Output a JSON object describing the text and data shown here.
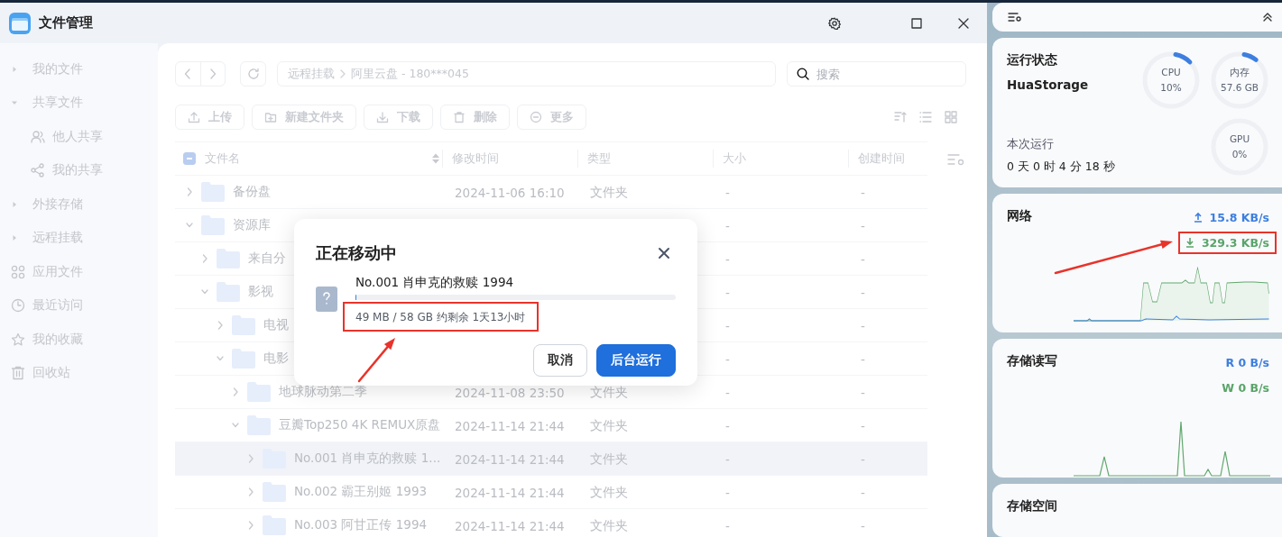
{
  "window": {
    "title": "文件管理"
  },
  "sidebar": {
    "items": [
      {
        "label": "我的文件",
        "kind": "group",
        "expanded": false
      },
      {
        "label": "共享文件",
        "kind": "group",
        "expanded": true,
        "children": [
          {
            "label": "他人共享",
            "kind": "link"
          },
          {
            "label": "我的共享",
            "kind": "link"
          }
        ]
      },
      {
        "label": "外接存储",
        "kind": "group",
        "expanded": false
      },
      {
        "label": "远程挂载",
        "kind": "group",
        "expanded": false
      },
      {
        "label": "应用文件",
        "kind": "link"
      },
      {
        "label": "最近访问",
        "kind": "link"
      },
      {
        "label": "我的收藏",
        "kind": "link"
      },
      {
        "label": "回收站",
        "kind": "link"
      }
    ]
  },
  "breadcrumb": [
    "远程挂载",
    "阿里云盘 - 180***045"
  ],
  "search": {
    "placeholder": "搜索"
  },
  "toolbar": {
    "buttons": [
      "上传",
      "新建文件夹",
      "下载",
      "删除",
      "更多"
    ]
  },
  "table": {
    "select_all_partial": true,
    "columns": [
      "文件名",
      "修改时间",
      "类型",
      "大小",
      "创建时间"
    ],
    "rows": [
      {
        "name": "备份盘",
        "expanded": false,
        "selected": false,
        "modified": "2024-11-06 16:10",
        "type": "文件夹",
        "size": "-",
        "created": "-"
      },
      {
        "name": "资源库",
        "expanded": true,
        "selected": false,
        "size": "-",
        "created": "-",
        "children": [
          {
            "name": "来自分",
            "expanded": false,
            "selected": false,
            "size": "-",
            "created": "-"
          },
          {
            "name": "影视",
            "expanded": true,
            "selected": false,
            "size": "-",
            "created": "-",
            "children": [
              {
                "name": "电视",
                "expanded": false,
                "selected": false,
                "size": "-",
                "created": "-"
              },
              {
                "name": "电影",
                "expanded": true,
                "selected": false,
                "size": "-",
                "created": "-",
                "children": [
                  {
                    "name": "地球脉动第二季",
                    "expanded": false,
                    "selected": false,
                    "modified": "2024-11-08 23:50",
                    "type": "文件夹",
                    "size": "-",
                    "created": "-"
                  },
                  {
                    "name": "豆瓣Top250 4K REMUX原盘",
                    "expanded": true,
                    "selected": false,
                    "modified": "2024-11-14 21:44",
                    "type": "文件夹",
                    "size": "-",
                    "created": "-",
                    "children": [
                      {
                        "name": "No.001 肖申克的救赎 1...",
                        "expanded": false,
                        "selected": true,
                        "modified": "2024-11-14 21:44",
                        "type": "文件夹",
                        "size": "-",
                        "created": "-"
                      },
                      {
                        "name": "No.002 霸王别姬 1993",
                        "expanded": false,
                        "selected": false,
                        "modified": "2024-11-14 21:44",
                        "type": "文件夹",
                        "size": "-",
                        "created": "-"
                      },
                      {
                        "name": "No.003 阿甘正传 1994",
                        "expanded": false,
                        "selected": false,
                        "modified": "2024-11-14 21:44",
                        "type": "文件夹",
                        "size": "-",
                        "created": "-"
                      }
                    ]
                  }
                ]
              }
            ]
          }
        ]
      }
    ]
  },
  "dialog": {
    "title": "正在移动中",
    "file": "No.001 肖申克的救赎 1994",
    "level": 0.001,
    "progress": "49 MB / 58 GB 约剩余 1天13小时",
    "highlighted": true,
    "buttons": [
      {
        "label": "取消",
        "kind": "secondary"
      },
      {
        "label": "后台运行",
        "kind": "primary"
      }
    ]
  },
  "monitor": {
    "cards": [
      {
        "kind": "status",
        "title": "运行状态",
        "host": "HuaStorage",
        "uptime_label": "本次运行",
        "uptime": "0 天 0 时 4 分 18 秒",
        "gauges": [
          {
            "label": "CPU",
            "value": "10%",
            "level": 0.1
          },
          {
            "label": "内存",
            "value": "57.6 GB",
            "level": 0.08
          },
          {
            "label": "GPU",
            "value": "0%"
          }
        ]
      },
      {
        "kind": "network",
        "title": "网络",
        "rates": [
          {
            "kind": "up",
            "text": "15.8 KB/s",
            "highlighted": false
          },
          {
            "kind": "down",
            "text": "329.3 KB/s",
            "highlighted": true
          }
        ]
      },
      {
        "kind": "disk",
        "title": "存储读写",
        "rates": [
          {
            "kind": "read",
            "text": "R  0 B/s",
            "highlighted": false
          },
          {
            "kind": "write",
            "text": "W 0 B/s",
            "highlighted": false
          }
        ]
      },
      {
        "kind": "space",
        "title": "存储空间"
      }
    ]
  }
}
